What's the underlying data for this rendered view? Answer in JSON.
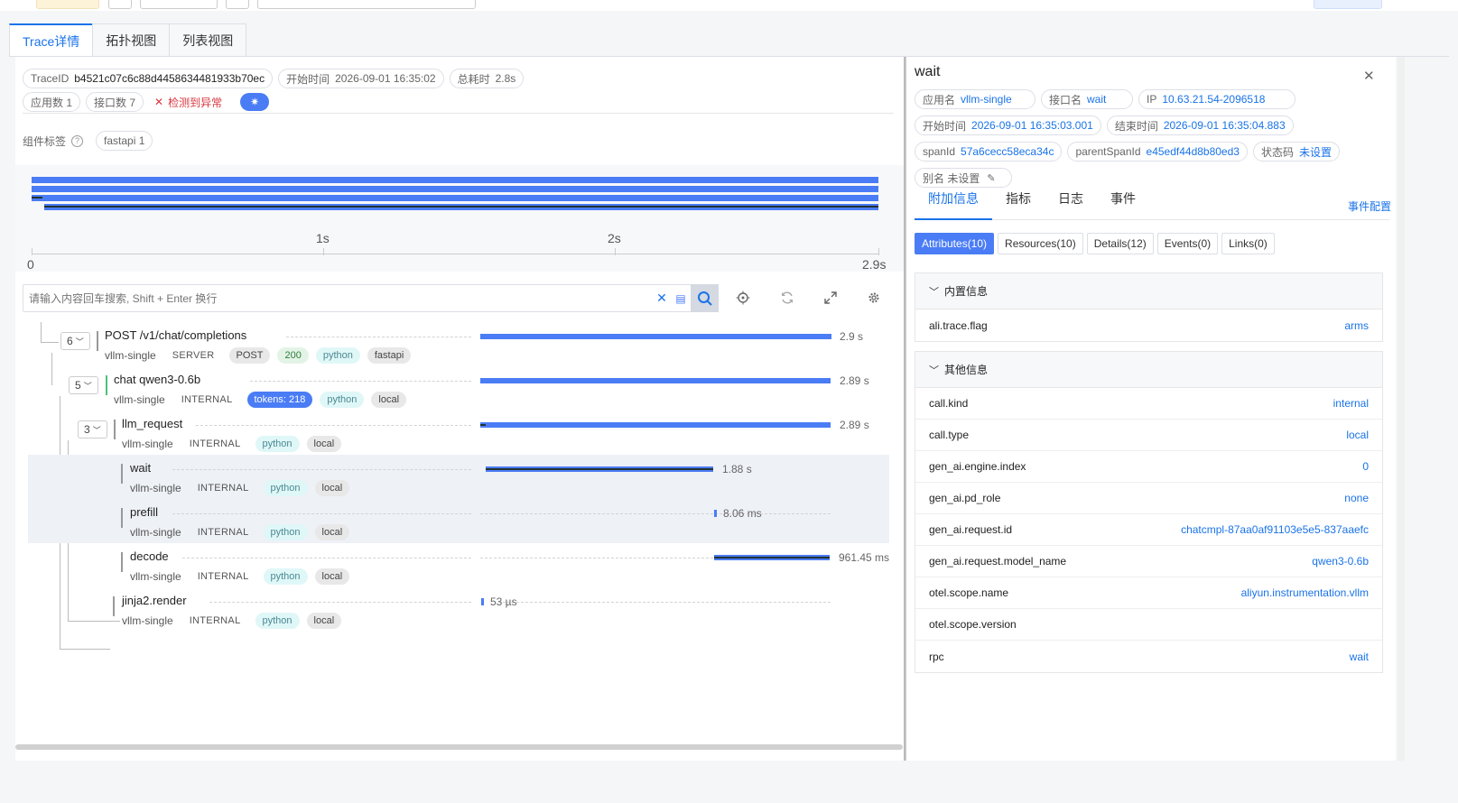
{
  "tabs": [
    {
      "label": "Trace详情",
      "active": true
    },
    {
      "label": "拓扑视图",
      "active": false
    },
    {
      "label": "列表视图",
      "active": false
    }
  ],
  "trace": {
    "traceid_label": "TraceID",
    "traceid": "b4521c07c6c88d4458634481933b70ec",
    "start_label": "开始时间",
    "start": "2026-09-01 16:35:02",
    "duration_label": "总耗时",
    "duration": "2.8s",
    "apps": "应用数 1",
    "apis": "接口数 7",
    "anomaly": "检测到异常",
    "component_label": "组件标签",
    "component_tag": "fastapi 1"
  },
  "timeline": {
    "ticks": [
      "0",
      "1s",
      "2s",
      "2.9s"
    ]
  },
  "search": {
    "placeholder": "请输入内容回车搜索, Shift + Enter 换行"
  },
  "spans": [
    {
      "count": "6",
      "name": "POST /v1/chat/completions",
      "app": "vllm-single",
      "kind": "SERVER",
      "tags": [
        "POST",
        "200",
        "python",
        "fastapi"
      ],
      "duration": "2.9 s"
    },
    {
      "count": "5",
      "name": "chat qwen3-0.6b",
      "app": "vllm-single",
      "kind": "INTERNAL",
      "tags": [
        "tokens: 218",
        "python",
        "local"
      ],
      "duration": "2.89 s"
    },
    {
      "count": "3",
      "name": "llm_request",
      "app": "vllm-single",
      "kind": "INTERNAL",
      "tags": [
        "python",
        "local"
      ],
      "duration": "2.89 s"
    },
    {
      "count": "",
      "name": "wait",
      "app": "vllm-single",
      "kind": "INTERNAL",
      "tags": [
        "python",
        "local"
      ],
      "duration": "1.88 s"
    },
    {
      "count": "",
      "name": "prefill",
      "app": "vllm-single",
      "kind": "INTERNAL",
      "tags": [
        "python",
        "local"
      ],
      "duration": "8.06 ms"
    },
    {
      "count": "",
      "name": "decode",
      "app": "vllm-single",
      "kind": "INTERNAL",
      "tags": [
        "python",
        "local"
      ],
      "duration": "961.45 ms"
    },
    {
      "count": "",
      "name": "jinja2.render",
      "app": "vllm-single",
      "kind": "INTERNAL",
      "tags": [
        "python",
        "local"
      ],
      "duration": "53 µs"
    }
  ],
  "detail": {
    "title": "wait",
    "app_label": "应用名",
    "app": "vllm-single",
    "api_label": "接口名",
    "api": "wait",
    "ip_label": "IP",
    "ip": "10.63.21.54-2096518",
    "start_label": "开始时间",
    "start": "2026-09-01 16:35:03.001",
    "end_label": "结束时间",
    "end": "2026-09-01 16:35:04.883",
    "spanid_label": "spanId",
    "spanid": "57a6cecc58eca34c",
    "parent_label": "parentSpanId",
    "parent": "e45edf44d8b80ed3",
    "status_label": "状态码",
    "status": "未设置",
    "alias": "别名 未设置",
    "subtabs": [
      "附加信息",
      "指标",
      "日志",
      "事件"
    ],
    "event_config": "事件配置",
    "segments": [
      "Attributes(10)",
      "Resources(10)",
      "Details(12)",
      "Events(0)",
      "Links(0)"
    ],
    "builtin_title": "内置信息",
    "builtin": [
      {
        "k": "ali.trace.flag",
        "v": "arms"
      }
    ],
    "other_title": "其他信息",
    "other": [
      {
        "k": "call.kind",
        "v": "internal"
      },
      {
        "k": "call.type",
        "v": "local"
      },
      {
        "k": "gen_ai.engine.index",
        "v": "0"
      },
      {
        "k": "gen_ai.pd_role",
        "v": "none"
      },
      {
        "k": "gen_ai.request.id",
        "v": "chatcmpl-87aa0af91103e5e5-837aaefc"
      },
      {
        "k": "gen_ai.request.model_name",
        "v": "qwen3-0.6b"
      },
      {
        "k": "otel.scope.name",
        "v": "aliyun.instrumentation.vllm"
      },
      {
        "k": "otel.scope.version",
        "v": ""
      },
      {
        "k": "rpc",
        "v": "wait"
      }
    ]
  },
  "colors": {
    "accent": "#1a73e8",
    "bar": "#4a7cf5",
    "anomaly": "#d9363e"
  }
}
